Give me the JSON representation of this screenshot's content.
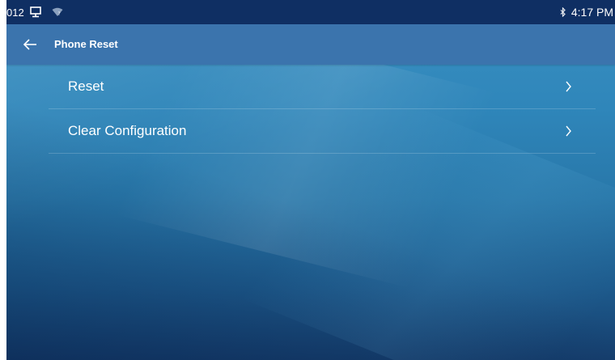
{
  "status_bar": {
    "left_text": "012",
    "icons": [
      "monitor-icon",
      "wifi-signal-icon"
    ],
    "bluetooth_icon": "bluetooth-icon",
    "time": "4:17 PM",
    "background_color": "#0f2f63"
  },
  "header": {
    "back_icon": "arrow-left-icon",
    "title": "Phone Reset",
    "background_color": "#3b74ad"
  },
  "menu": {
    "items": [
      {
        "label": "Reset",
        "icon": "chevron-right-icon"
      },
      {
        "label": "Clear Configuration",
        "icon": "chevron-right-icon"
      }
    ]
  },
  "colors": {
    "text": "#ffffff",
    "wallpaper_top": "#3a90c2",
    "wallpaper_bottom": "#163f6e"
  }
}
